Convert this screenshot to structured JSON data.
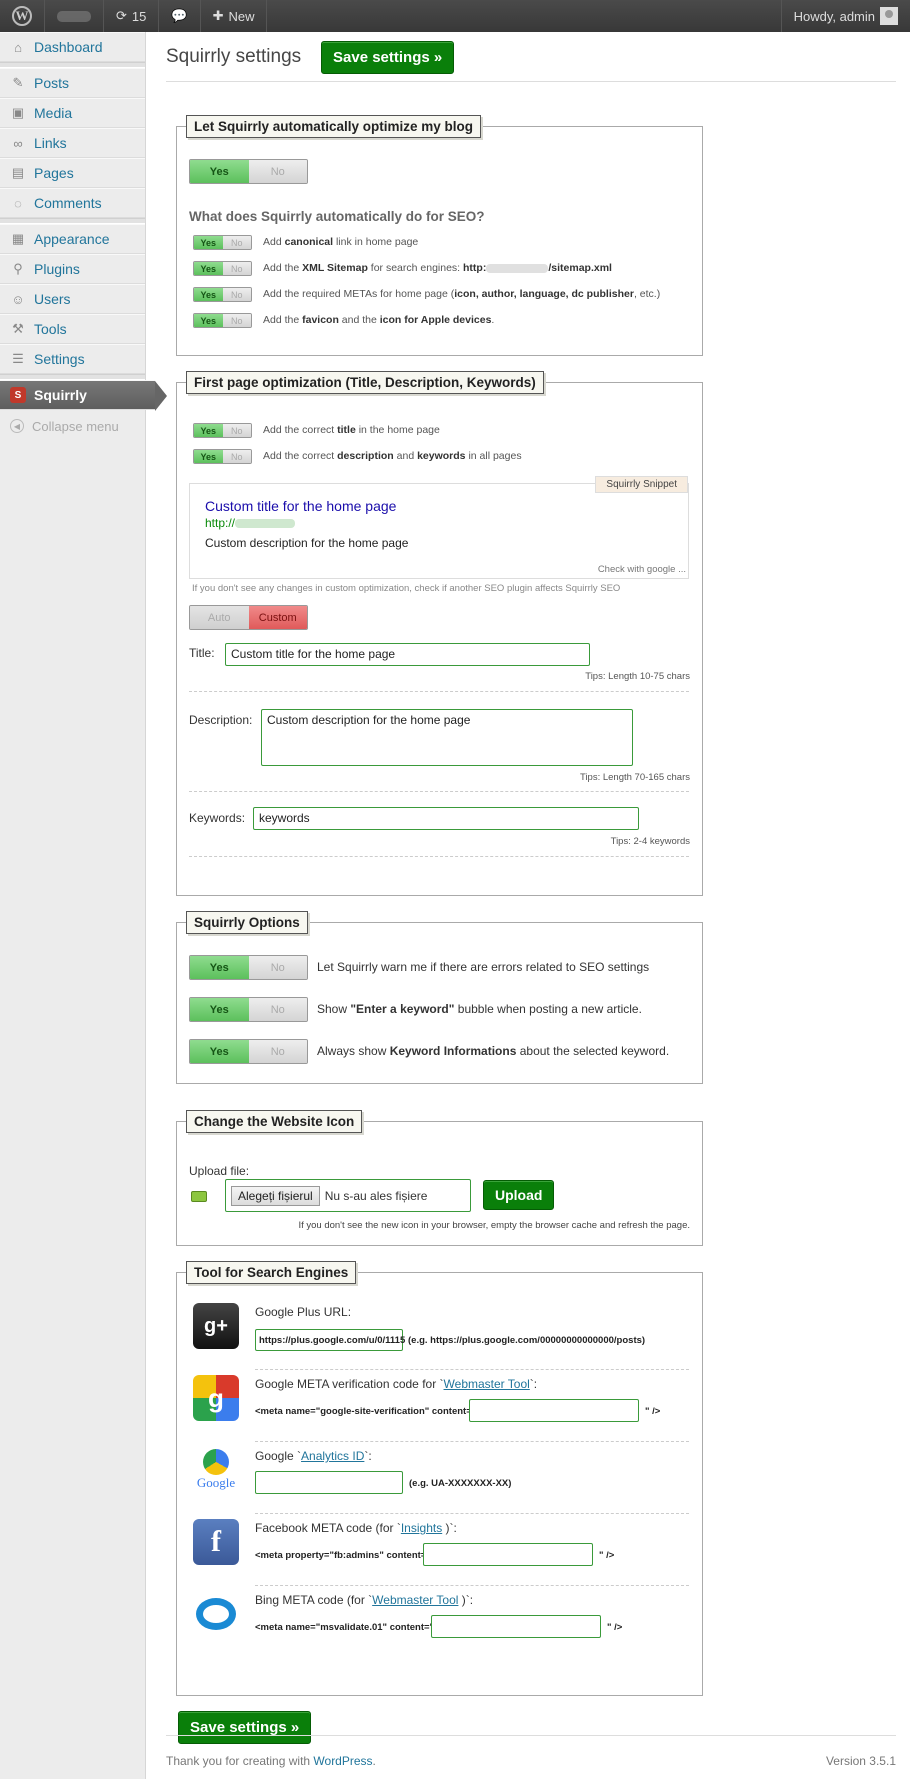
{
  "adminbar": {
    "updates_count": "15",
    "new_label": "New",
    "howdy": "Howdy, admin"
  },
  "sidebar": {
    "items": [
      {
        "label": "Dashboard",
        "icon": "dashboard-icon"
      },
      {
        "label": "Posts",
        "icon": "pin-icon"
      },
      {
        "label": "Media",
        "icon": "media-icon"
      },
      {
        "label": "Links",
        "icon": "link-icon"
      },
      {
        "label": "Pages",
        "icon": "pages-icon"
      },
      {
        "label": "Comments",
        "icon": "comment-icon"
      },
      {
        "label": "Appearance",
        "icon": "appearance-icon"
      },
      {
        "label": "Plugins",
        "icon": "plugin-icon"
      },
      {
        "label": "Users",
        "icon": "users-icon"
      },
      {
        "label": "Tools",
        "icon": "tools-icon"
      },
      {
        "label": "Settings",
        "icon": "settings-icon"
      },
      {
        "label": "Squirrly",
        "icon": "squirrly-icon"
      }
    ],
    "collapse": "Collapse menu"
  },
  "header": {
    "title": "Squirrly settings",
    "save_label": "Save settings »"
  },
  "section1": {
    "legend": "Let Squirrly automatically optimize my blog",
    "yes": "Yes",
    "no": "No",
    "heading": "What does Squirrly automatically do for SEO?",
    "rows": [
      {
        "pre": "Add ",
        "bold": "canonical",
        "post": " link in home page"
      },
      {
        "pre": "Add the ",
        "bold": "XML Sitemap",
        "mid": " for search engines: ",
        "bold2": "http:",
        "post": "/sitemap.xml"
      },
      {
        "pre": "Add the required METAs for home page (",
        "bold": "icon, author, language, dc publisher",
        "post": ", etc.)"
      },
      {
        "pre": "Add the ",
        "bold": "favicon",
        "mid": " and the ",
        "bold2": "icon for Apple devices",
        "post": "."
      }
    ]
  },
  "section2": {
    "legend": "First page optimization (Title, Description, Keywords)",
    "rows": [
      {
        "pre": "Add the correct ",
        "bold": "title",
        "post": " in the home page"
      },
      {
        "pre": "Add the correct ",
        "bold": "description",
        "mid": " and ",
        "bold2": "keywords",
        "post": " in all pages"
      }
    ],
    "snippet_tag": "Squirrly Snippet",
    "snippet_title": "Custom title for the home page",
    "snippet_url": "http://",
    "snippet_desc": "Custom description for the home page",
    "check_google": "Check with google ...",
    "note": "If you don't see any changes in custom optimization, check if another SEO plugin affects Squirrly SEO",
    "auto": "Auto",
    "custom": "Custom",
    "title_label": "Title:",
    "title_value": "Custom title for the home page",
    "title_tips": "Tips: Length 10-75 chars",
    "desc_label": "Description:",
    "desc_value": "Custom description for the home page",
    "desc_tips": "Tips: Length 70-165 chars",
    "kw_label": "Keywords:",
    "kw_value": "keywords",
    "kw_tips": "Tips: 2-4 keywords"
  },
  "section3": {
    "legend": "Squirrly Options",
    "opt1": "Let Squirrly warn me if there are errors related to SEO settings",
    "opt2_pre": "Show ",
    "opt2_bold": "\"Enter a keyword\"",
    "opt2_post": " bubble when posting a new article.",
    "opt3_pre": "Always show ",
    "opt3_bold": "Keyword Informations",
    "opt3_post": " about the selected keyword."
  },
  "section4": {
    "legend": "Change the Website Icon",
    "upload_label": "Upload file:",
    "choose_btn": "Alegeți fișierul",
    "no_file": "Nu s-au ales fișiere",
    "upload_btn": "Upload",
    "note": "If you don't see the new icon in your browser, empty the browser cache and refresh the page."
  },
  "section5": {
    "legend": "Tool for Search Engines",
    "gplus_label": "Google Plus URL:",
    "gplus_value": "https://plus.google.com/u/0/1115",
    "gplus_eg": "(e.g. https://plus.google.com/00000000000000/posts)",
    "gmeta_pre": "Google META verification code for `",
    "gmeta_link": "Webmaster Tool",
    "gmeta_post": "`:",
    "gmeta_code": "<meta name=\"google-site-verification\" content=\"",
    "close_tag": "\" />",
    "ga_pre": "Google `",
    "ga_link": "Analytics ID",
    "ga_post": "`:",
    "ga_eg": "(e.g. UA-XXXXXXX-XX)",
    "fb_pre": "Facebook META code (for `",
    "fb_link": "Insights",
    "fb_post": " )`:",
    "fb_code": "<meta property=\"fb:admins\" content=\"",
    "bing_pre": "Bing META code (for `",
    "bing_link": "Webmaster Tool",
    "bing_post": " )`:",
    "bing_code": "<meta name=\"msvalidate.01\" content=\""
  },
  "footer": {
    "thanks": "Thank you for creating with ",
    "wp_link": "WordPress",
    "period": ".",
    "version": "Version 3.5.1"
  },
  "colors": {
    "accent_green": "#0a7f0a",
    "link_blue": "#21759b",
    "custom_red": "#e05a5a"
  }
}
